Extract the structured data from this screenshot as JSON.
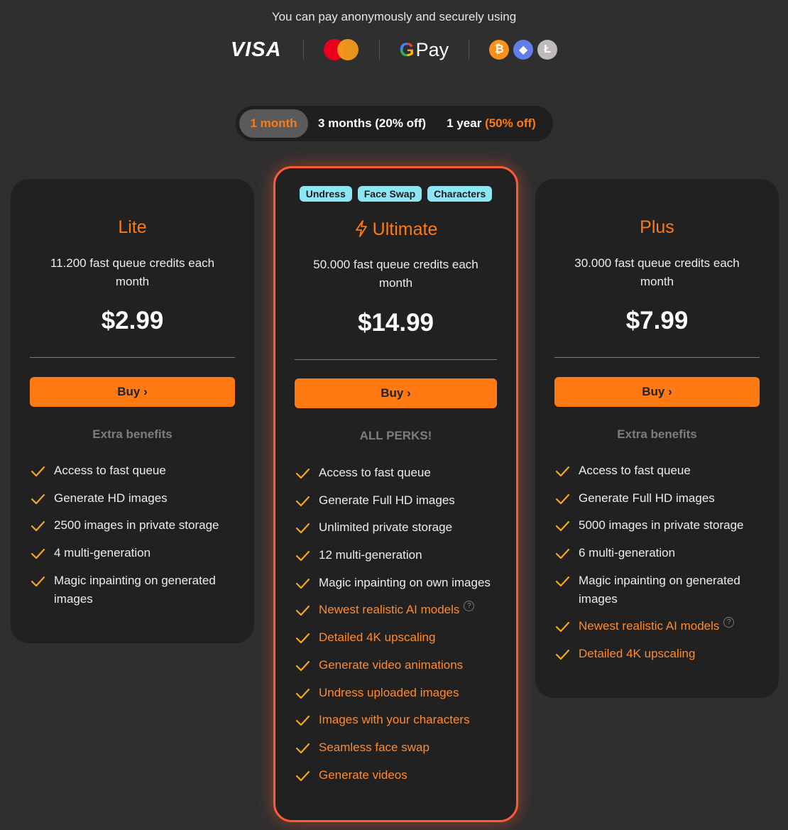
{
  "payment": {
    "caption": "You can pay anonymously and securely using",
    "visa": "VISA",
    "gpay": "Pay",
    "gpay_g": "G",
    "crypto_icons": [
      "bitcoin-icon",
      "ethereum-icon",
      "litecoin-icon"
    ]
  },
  "period_toggle": {
    "options": [
      {
        "label": "1 month",
        "selected": true
      },
      {
        "label": "3 months (20% off)",
        "selected": false
      },
      {
        "label": "1 year",
        "suffix": "(50% off)",
        "selected": false
      }
    ]
  },
  "colors": {
    "accent": "#ff7a12",
    "card_bg": "#212121",
    "page_bg": "#2f2f2f",
    "highlight_border": "#ff5a36",
    "tag_bg": "#8ee6f4"
  },
  "plans": {
    "lite": {
      "title": "Lite",
      "credits": "11.200 fast queue credits each month",
      "price": "$2.99",
      "buy": "Buy ›",
      "perks_label": "Extra benefits",
      "features": [
        "Access to fast queue",
        "Generate HD images",
        "2500 images in private storage",
        "4 multi-generation",
        "Magic inpainting on generated images"
      ]
    },
    "ultimate": {
      "tags": [
        "Undress",
        "Face Swap",
        "Characters"
      ],
      "title": "Ultimate",
      "credits": "50.000 fast queue credits each month",
      "price": "$14.99",
      "buy": "Buy ›",
      "perks_label": "ALL PERKS!",
      "features": [
        "Access to fast queue",
        "Generate Full HD images",
        "Unlimited private storage",
        "12 multi-generation",
        "Magic inpainting on own images",
        "Newest realistic AI models",
        "Detailed 4K upscaling",
        "Generate video animations",
        "Undress uploaded images",
        "Images with your characters",
        "Seamless face swap",
        "Generate videos"
      ]
    },
    "plus": {
      "title": "Plus",
      "credits": "30.000 fast queue credits each month",
      "price": "$7.99",
      "buy": "Buy ›",
      "perks_label": "Extra benefits",
      "features": [
        "Access to fast queue",
        "Generate Full HD images",
        "5000 images in private storage",
        "6 multi-generation",
        "Magic inpainting on generated images",
        "Newest realistic AI models",
        "Detailed 4K upscaling"
      ]
    }
  }
}
